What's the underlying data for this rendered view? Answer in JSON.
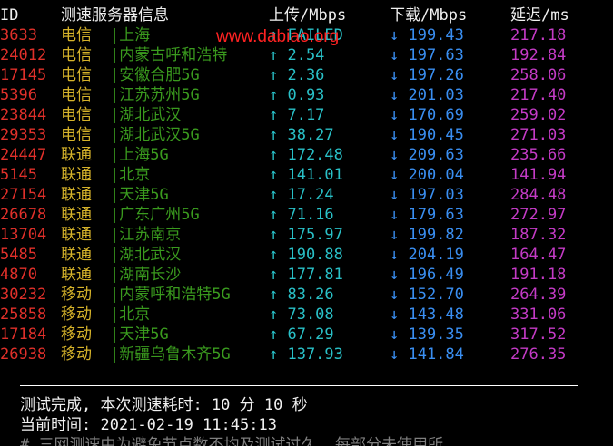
{
  "header": {
    "id": "ID",
    "node": "测速服务器信息",
    "upload": "上传/Mbps",
    "download": "下载/Mbps",
    "latency": "延迟/ms"
  },
  "watermark": "www.dabiao.org",
  "rows": [
    {
      "id": "3633",
      "isp": "电信",
      "node": "|上海",
      "up": "↑ FAILED",
      "down": "↓ 199.43",
      "latency": "217.18"
    },
    {
      "id": "24012",
      "isp": "电信",
      "node": "|内蒙古呼和浩特",
      "up": "↑ 2.54",
      "down": "↓ 197.63",
      "latency": "192.84"
    },
    {
      "id": "17145",
      "isp": "电信",
      "node": "|安徽合肥5G",
      "up": "↑ 2.36",
      "down": "↓ 197.26",
      "latency": "258.06"
    },
    {
      "id": "5396",
      "isp": "电信",
      "node": "|江苏苏州5G",
      "up": "↑ 0.93",
      "down": "↓ 201.03",
      "latency": "217.40"
    },
    {
      "id": "23844",
      "isp": "电信",
      "node": "|湖北武汉",
      "up": "↑ 7.17",
      "down": "↓ 170.69",
      "latency": "259.02"
    },
    {
      "id": "29353",
      "isp": "电信",
      "node": "|湖北武汉5G",
      "up": "↑ 38.27",
      "down": "↓ 190.45",
      "latency": "271.03"
    },
    {
      "id": "24447",
      "isp": "联通",
      "node": "|上海5G",
      "up": "↑ 172.48",
      "down": "↓ 209.63",
      "latency": "235.66"
    },
    {
      "id": "5145",
      "isp": "联通",
      "node": "|北京",
      "up": "↑ 141.01",
      "down": "↓ 200.04",
      "latency": "141.94"
    },
    {
      "id": "27154",
      "isp": "联通",
      "node": "|天津5G",
      "up": "↑ 17.24",
      "down": "↓ 197.03",
      "latency": "284.48"
    },
    {
      "id": "26678",
      "isp": "联通",
      "node": "|广东广州5G",
      "up": "↑ 71.16",
      "down": "↓ 179.63",
      "latency": "272.97"
    },
    {
      "id": "13704",
      "isp": "联通",
      "node": "|江苏南京",
      "up": "↑ 175.97",
      "down": "↓ 199.82",
      "latency": "187.32"
    },
    {
      "id": "5485",
      "isp": "联通",
      "node": "|湖北武汉",
      "up": "↑ 190.88",
      "down": "↓ 204.19",
      "latency": "164.47"
    },
    {
      "id": "4870",
      "isp": "联通",
      "node": "|湖南长沙",
      "up": "↑ 177.81",
      "down": "↓ 196.49",
      "latency": "191.18"
    },
    {
      "id": "30232",
      "isp": "移动",
      "node": "|内蒙呼和浩特5G",
      "up": "↑ 83.26",
      "down": "↓ 152.70",
      "latency": "264.39"
    },
    {
      "id": "25858",
      "isp": "移动",
      "node": "|北京",
      "up": "↑ 73.08",
      "down": "↓ 143.48",
      "latency": "331.06"
    },
    {
      "id": "17184",
      "isp": "移动",
      "node": "|天津5G",
      "up": "↑ 67.29",
      "down": "↓ 139.35",
      "latency": "317.52"
    },
    {
      "id": "26938",
      "isp": "移动",
      "node": "|新疆乌鲁木齐5G",
      "up": "↑ 137.93",
      "down": "↓ 141.84",
      "latency": "276.35"
    }
  ],
  "summary": {
    "completed": "测试完成, 本次测速耗时: 10 分 10 秒",
    "current_time": "当前时间: 2021-02-19 11:45:13",
    "note": "# 三网测速中为避免节点数不均及测试过久, 每部分未使用所"
  },
  "colors": {
    "background": "#000000",
    "id": "#e0302a",
    "isp": "#d6b32a",
    "node": "#3a9a1e",
    "upload": "#29c0c7",
    "download": "#3a8ff2",
    "latency": "#c43bc6",
    "watermark": "#ff2222"
  }
}
